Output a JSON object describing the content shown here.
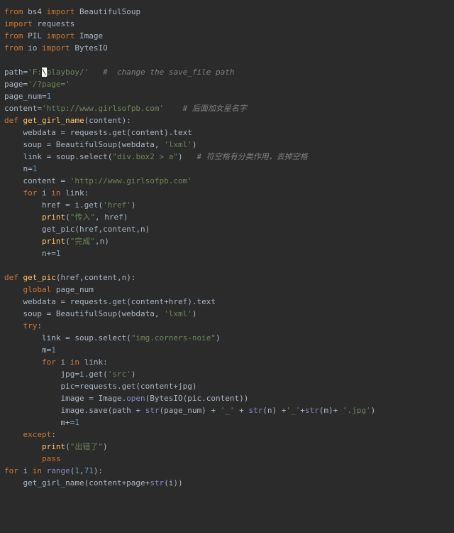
{
  "code": {
    "l1": {
      "kw1": "from",
      "mod": " bs4 ",
      "kw2": "import",
      "name": " BeautifulSoup"
    },
    "l2": {
      "kw1": "import",
      "name": " requests"
    },
    "l3": {
      "kw1": "from",
      "mod": " PIL ",
      "kw2": "import",
      "name": " Image"
    },
    "l4": {
      "kw1": "from",
      "mod": " io ",
      "kw2": "import",
      "name": " BytesIO"
    },
    "l6": {
      "var": "path=",
      "s1": "'F:",
      "caret": "\\",
      "s2": "playboy/'",
      "sp": "   ",
      "c": "#  change the save_file path"
    },
    "l7": {
      "var": "page=",
      "s": "'/?page='"
    },
    "l8": {
      "var": "page_num=",
      "n": "1"
    },
    "l9": {
      "var": "content=",
      "s": "'http://www.girlsofpb.com'",
      "sp": "    ",
      "c": "# 后面加女星名字"
    },
    "l10": {
      "kw": "def ",
      "fn": "get_girl_name",
      "args": "(content):"
    },
    "l11": "    webdata = requests.get(content).text",
    "l12": {
      "pre": "    soup = BeautifulSoup(webdata, ",
      "s": "'lxml'",
      "post": ")"
    },
    "l13": {
      "pre": "    link = soup.select(",
      "s": "\"div.box2 > a\"",
      "mid": ")   ",
      "c": "# 符空格有分类作用，去掉空格"
    },
    "l14": {
      "pre": "    n=",
      "n": "1"
    },
    "l15": {
      "pre": "    content = ",
      "s": "'http://www.girlsofpb.com'"
    },
    "l16": {
      "kw1": "    for ",
      "var": "i",
      "kw2": " in ",
      "rest": "link:"
    },
    "l17": {
      "pre": "        href = i.get(",
      "s": "'href'",
      "post": ")"
    },
    "l18": {
      "pre": "        ",
      "fn": "print",
      "mid": "(",
      "s": "\"传入\"",
      "post": ", href)"
    },
    "l19": {
      "pre": "        get_pic(href,content,n)"
    },
    "l20": {
      "pre": "        ",
      "fn": "print",
      "mid": "(",
      "s": "\"完成\"",
      "post": ",n)"
    },
    "l21": {
      "pre": "        n+=",
      "n": "1"
    },
    "l23": {
      "kw": "def ",
      "fn": "get_pic",
      "args": "(href,content,n):"
    },
    "l24": {
      "kw": "    global ",
      "rest": "page_num"
    },
    "l25": "    webdata = requests.get(content+href).text",
    "l26": {
      "pre": "    soup = BeautifulSoup(webdata, ",
      "s": "'lxml'",
      "post": ")"
    },
    "l27": {
      "kw": "    try",
      "rest": ":"
    },
    "l28": {
      "pre": "        link = soup.select(",
      "s": "\"img.corners-noie\"",
      "post": ")"
    },
    "l29": {
      "pre": "        m=",
      "n": "1"
    },
    "l30": {
      "kw1": "        for ",
      "var": "i",
      "kw2": " in ",
      "rest": "link:"
    },
    "l31": {
      "pre": "            jpg=i.get(",
      "s": "'src'",
      "post": ")"
    },
    "l32": "            pic=requests.get(content+jpg)",
    "l33": {
      "pre": "            image = Image.",
      "fn": "open",
      "post": "(BytesIO(pic.content))"
    },
    "l34": {
      "pre": "            image.save(path + ",
      "bi1": "str",
      "a": "(page_num) + ",
      "s1": "'_'",
      "b": " + ",
      "bi2": "str",
      "c": "(n) +",
      "s2": "'_'",
      "d": "+",
      "bi3": "str",
      "e": "(m)+ ",
      "s3": "'.jpg'",
      "post": ")"
    },
    "l35": {
      "pre": "            m+=",
      "n": "1"
    },
    "l36": {
      "kw": "    except",
      "rest": ":"
    },
    "l37": {
      "pre": "        ",
      "fn": "print",
      "mid": "(",
      "s": "\"出错了\"",
      "post": ")"
    },
    "l38": {
      "kw": "        pass"
    },
    "l39": {
      "kw1": "for ",
      "var": "i",
      "kw2": " in ",
      "bi": "range",
      "mid": "(",
      "n1": "1",
      "sep": ",",
      "n2": "71",
      "post": "):"
    },
    "l40": {
      "pre": "    get_girl_name(content+page+",
      "bi": "str",
      "post": "(i))"
    }
  }
}
